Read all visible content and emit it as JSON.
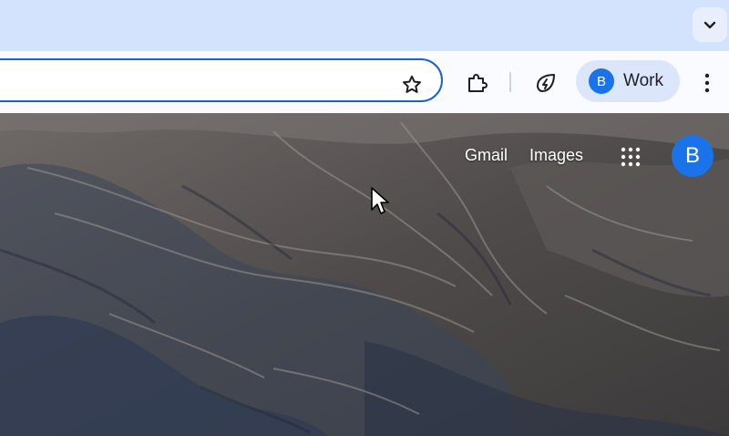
{
  "toolbar": {
    "profile": {
      "initial": "B",
      "label": "Work"
    }
  },
  "content": {
    "links": {
      "gmail": "Gmail",
      "images": "Images"
    },
    "account_initial": "B"
  },
  "icons": {
    "tab_search": "chevron-down-icon",
    "bookmark": "star-icon",
    "extensions": "puzzle-icon",
    "performance": "leaf-bolt-icon",
    "menu": "more-vert-icon",
    "apps": "apps-grid-icon",
    "cursor": "mouse-pointer-icon"
  },
  "colors": {
    "tabstrip": "#d3e3fd",
    "toolbar": "#f9fbff",
    "omnibox_focus": "#1a62d0",
    "avatar": "#1a73e8",
    "profile_chip": "#dbe6fb"
  }
}
